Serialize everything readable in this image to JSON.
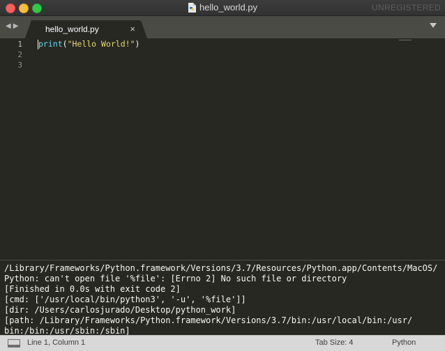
{
  "window": {
    "title": "hello_world.py",
    "unregistered": "UNREGISTERED"
  },
  "tabs": [
    {
      "label": "hello_world.py",
      "close": "×"
    }
  ],
  "nav": {
    "back": "◀",
    "forward": "▶"
  },
  "editor": {
    "line_numbers": [
      "1",
      "2",
      "3"
    ],
    "code": {
      "func": "print",
      "open": "(",
      "string": "\"Hello World!\"",
      "close": ")"
    }
  },
  "output": {
    "lines": [
      "/Library/Frameworks/Python.framework/Versions/3.7/Resources/Python.app/Contents/MacOS/",
      "Python: can't open file '%file': [Errno 2] No such file or directory",
      "[Finished in 0.0s with exit code 2]",
      "[cmd: ['/usr/local/bin/python3', '-u', '%file']]",
      "[dir: /Users/carlosjurado/Desktop/python_work]",
      "[path: /Library/Frameworks/Python.framework/Versions/3.7/bin:/usr/local/bin:/usr/",
      "bin:/bin:/usr/sbin:/sbin]"
    ]
  },
  "status": {
    "position": "Line 1, Column 1",
    "tab_size": "Tab Size: 4",
    "syntax": "Python"
  },
  "colors": {
    "editor_bg": "#272822",
    "keyword": "#66d9ef",
    "string": "#e6db74",
    "text": "#f8f8f2"
  }
}
